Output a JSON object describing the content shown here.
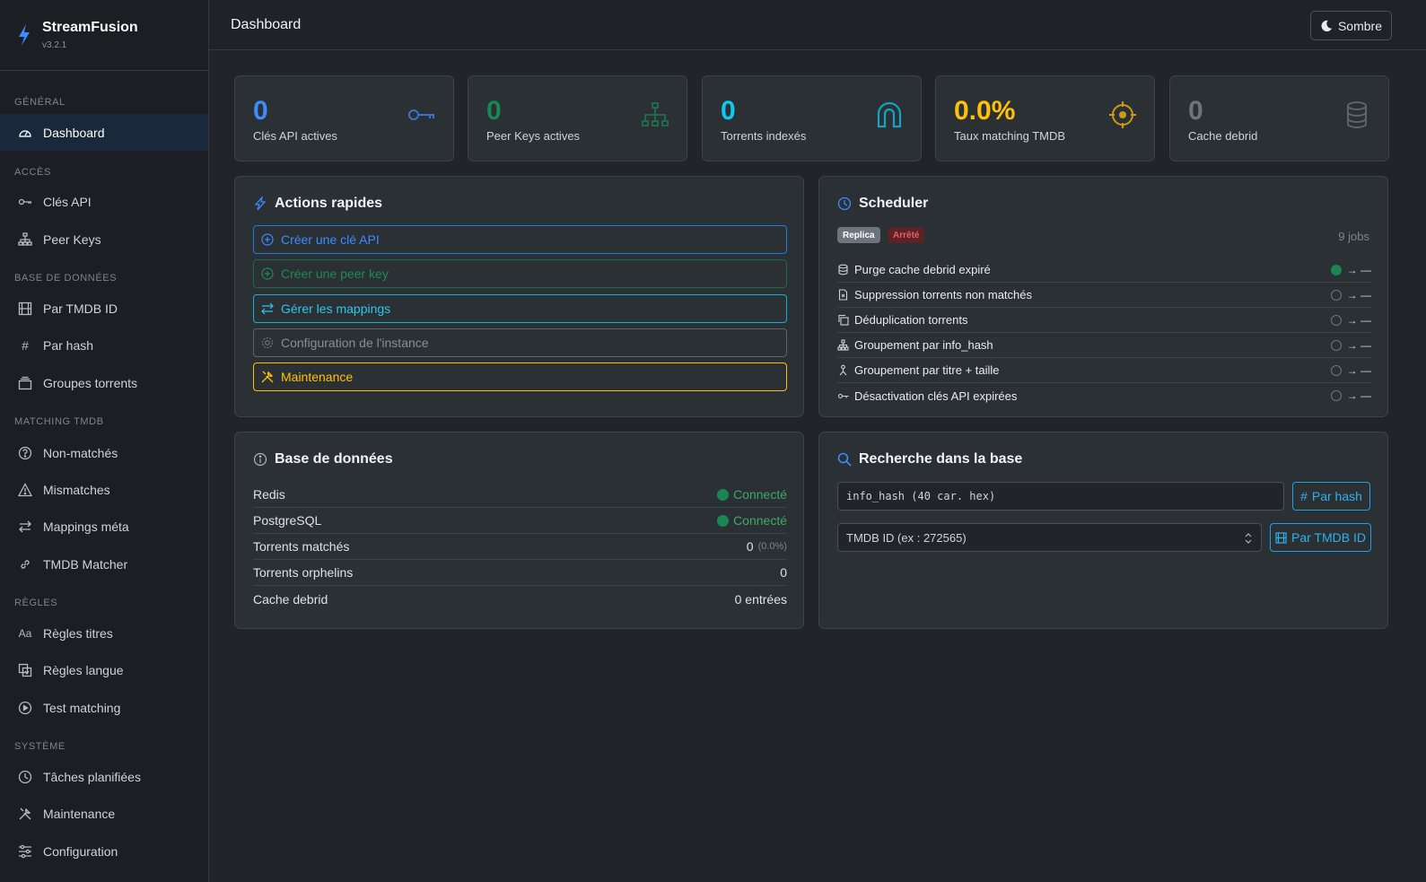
{
  "brand": {
    "name": "StreamFusion",
    "version": "v3.2.1"
  },
  "sidebar": {
    "sections": {
      "general": "GÉNÉRAL",
      "acces": "ACCÈS",
      "db": "BASE DE DONNÉES",
      "matching": "MATCHING TMDB",
      "regles": "RÈGLES",
      "systeme": "SYSTÈME"
    },
    "items": {
      "dashboard": "Dashboard",
      "cles_api": "Clés API",
      "peer_keys": "Peer Keys",
      "par_tmdb": "Par TMDB ID",
      "par_hash": "Par hash",
      "groupes": "Groupes torrents",
      "non_matches": "Non-matchés",
      "mismatches": "Mismatches",
      "mappings": "Mappings méta",
      "tmdb_matcher": "TMDB Matcher",
      "regles_titres": "Règles titres",
      "regles_langue": "Règles langue",
      "test_matching": "Test matching",
      "taches": "Tâches planifiées",
      "maintenance": "Maintenance",
      "configuration": "Configuration"
    },
    "hash_glyph": "#",
    "aa_glyph": "Aa"
  },
  "header": {
    "title": "Dashboard",
    "theme_label": "Sombre"
  },
  "stats": [
    {
      "value": "0",
      "label": "Clés API actives",
      "color": "#3d8bfd",
      "icon": "key-icon"
    },
    {
      "value": "0",
      "label": "Peer Keys actives",
      "color": "#198754",
      "icon": "network-icon"
    },
    {
      "value": "0",
      "label": "Torrents indexés",
      "color": "#0dcaf0",
      "icon": "magnet-icon"
    },
    {
      "value": "0.0%",
      "label": "Taux matching TMDB",
      "color": "#ffc107",
      "icon": "crosshair-icon"
    },
    {
      "value": "0",
      "label": "Cache debrid",
      "color": "#6c757d",
      "icon": "database-icon"
    }
  ],
  "quick_actions": {
    "title": "Actions rapides",
    "create_api": "Créer une clé API",
    "create_peer": "Créer une peer key",
    "manage_mappings": "Gérer les mappings",
    "config_instance": "Configuration de l'instance",
    "maintenance": "Maintenance"
  },
  "scheduler": {
    "title": "Scheduler",
    "badge_replica": "Replica",
    "badge_stopped": "Arrêté",
    "jobs_count": "9 jobs",
    "arrow": "→ —",
    "jobs": [
      "Purge cache debrid expiré",
      "Suppression torrents non matchés",
      "Déduplication torrents",
      "Groupement par info_hash",
      "Groupement par titre + taille",
      "Désactivation clés API expirées"
    ]
  },
  "database": {
    "title": "Base de données",
    "rows": {
      "redis_label": "Redis",
      "redis_value": "Connecté",
      "pg_label": "PostgreSQL",
      "pg_value": "Connecté",
      "matched_label": "Torrents matchés",
      "matched_value": "0",
      "matched_pct": "(0.0%)",
      "orphans_label": "Torrents orphelins",
      "orphans_value": "0",
      "cache_label": "Cache debrid",
      "cache_value": "0 entrées"
    }
  },
  "search": {
    "title": "Recherche dans la base",
    "hash_placeholder": "info_hash (40 car. hex)",
    "hash_button": "Par hash",
    "tmdb_placeholder": "TMDB ID (ex : 272565)",
    "tmdb_button": "Par TMDB ID"
  }
}
